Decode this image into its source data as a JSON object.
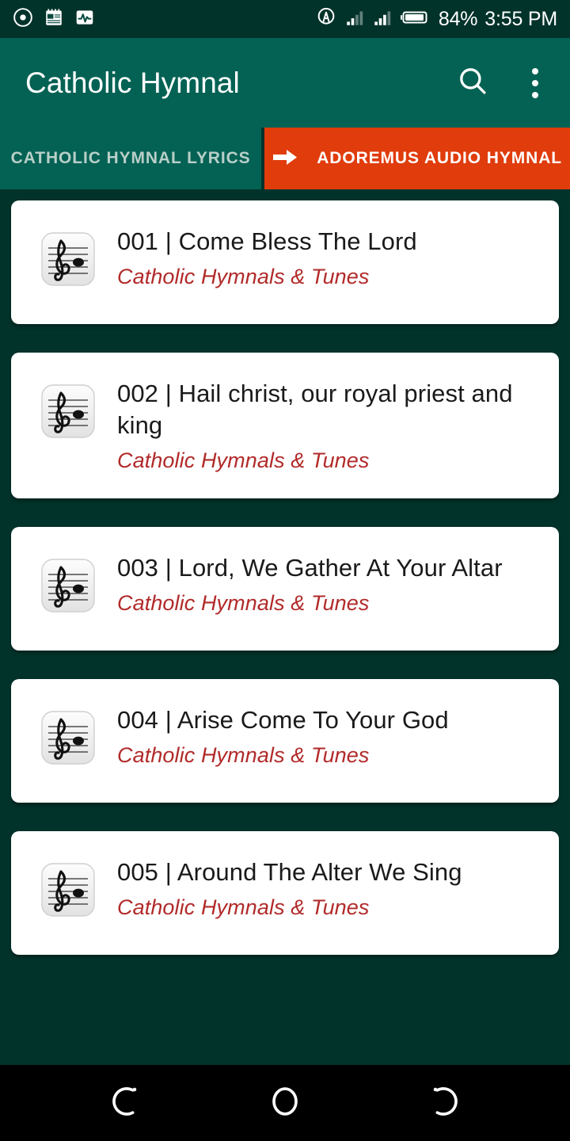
{
  "status_bar": {
    "left_icons": [
      "record-circle-icon",
      "calendar-note-icon",
      "activity-pulse-icon"
    ],
    "right_icons": [
      "hotspot-icon",
      "signal-bars-1-icon",
      "signal-bars-2-icon",
      "battery-icon"
    ],
    "battery_text": "84%",
    "time_text": "3:55 PM"
  },
  "app_bar": {
    "title": "Catholic Hymnal",
    "search_icon": "search-icon",
    "overflow_icon": "overflow-menu-icon"
  },
  "tabs": [
    {
      "label": "CATHOLIC HYMNAL LYRICS",
      "active": true,
      "icon": null
    },
    {
      "label": "ADOREMUS AUDIO HYMNAL",
      "active": false,
      "icon": "arrow-right-icon"
    }
  ],
  "hymns": [
    {
      "title": "001 | Come Bless The Lord",
      "subtitle": "Catholic Hymnals & Tunes",
      "icon": "music-sheet-icon"
    },
    {
      "title": "002 | Hail christ, our royal priest and king",
      "subtitle": "Catholic Hymnals & Tunes",
      "icon": "music-sheet-icon"
    },
    {
      "title": "003 | Lord, We Gather At Your Altar",
      "subtitle": "Catholic Hymnals & Tunes",
      "icon": "music-sheet-icon"
    },
    {
      "title": "004 | Arise Come To Your God",
      "subtitle": "Catholic Hymnals & Tunes",
      "icon": "music-sheet-icon"
    },
    {
      "title": "005 | Around The Alter We Sing",
      "subtitle": "Catholic Hymnals & Tunes",
      "icon": "music-sheet-icon"
    }
  ],
  "nav_bar": {
    "buttons": [
      {
        "name": "back-button",
        "icon": "nav-back-icon"
      },
      {
        "name": "home-button",
        "icon": "nav-home-icon"
      },
      {
        "name": "recents-button",
        "icon": "nav-recents-icon"
      }
    ]
  },
  "colors": {
    "app_bar_teal": "#046254",
    "background_dark_teal": "#02332b",
    "accent_orange": "#e03c0c",
    "subtitle_red": "#b22a2a",
    "card_white": "#ffffff",
    "nav_bar_black": "#000000"
  }
}
